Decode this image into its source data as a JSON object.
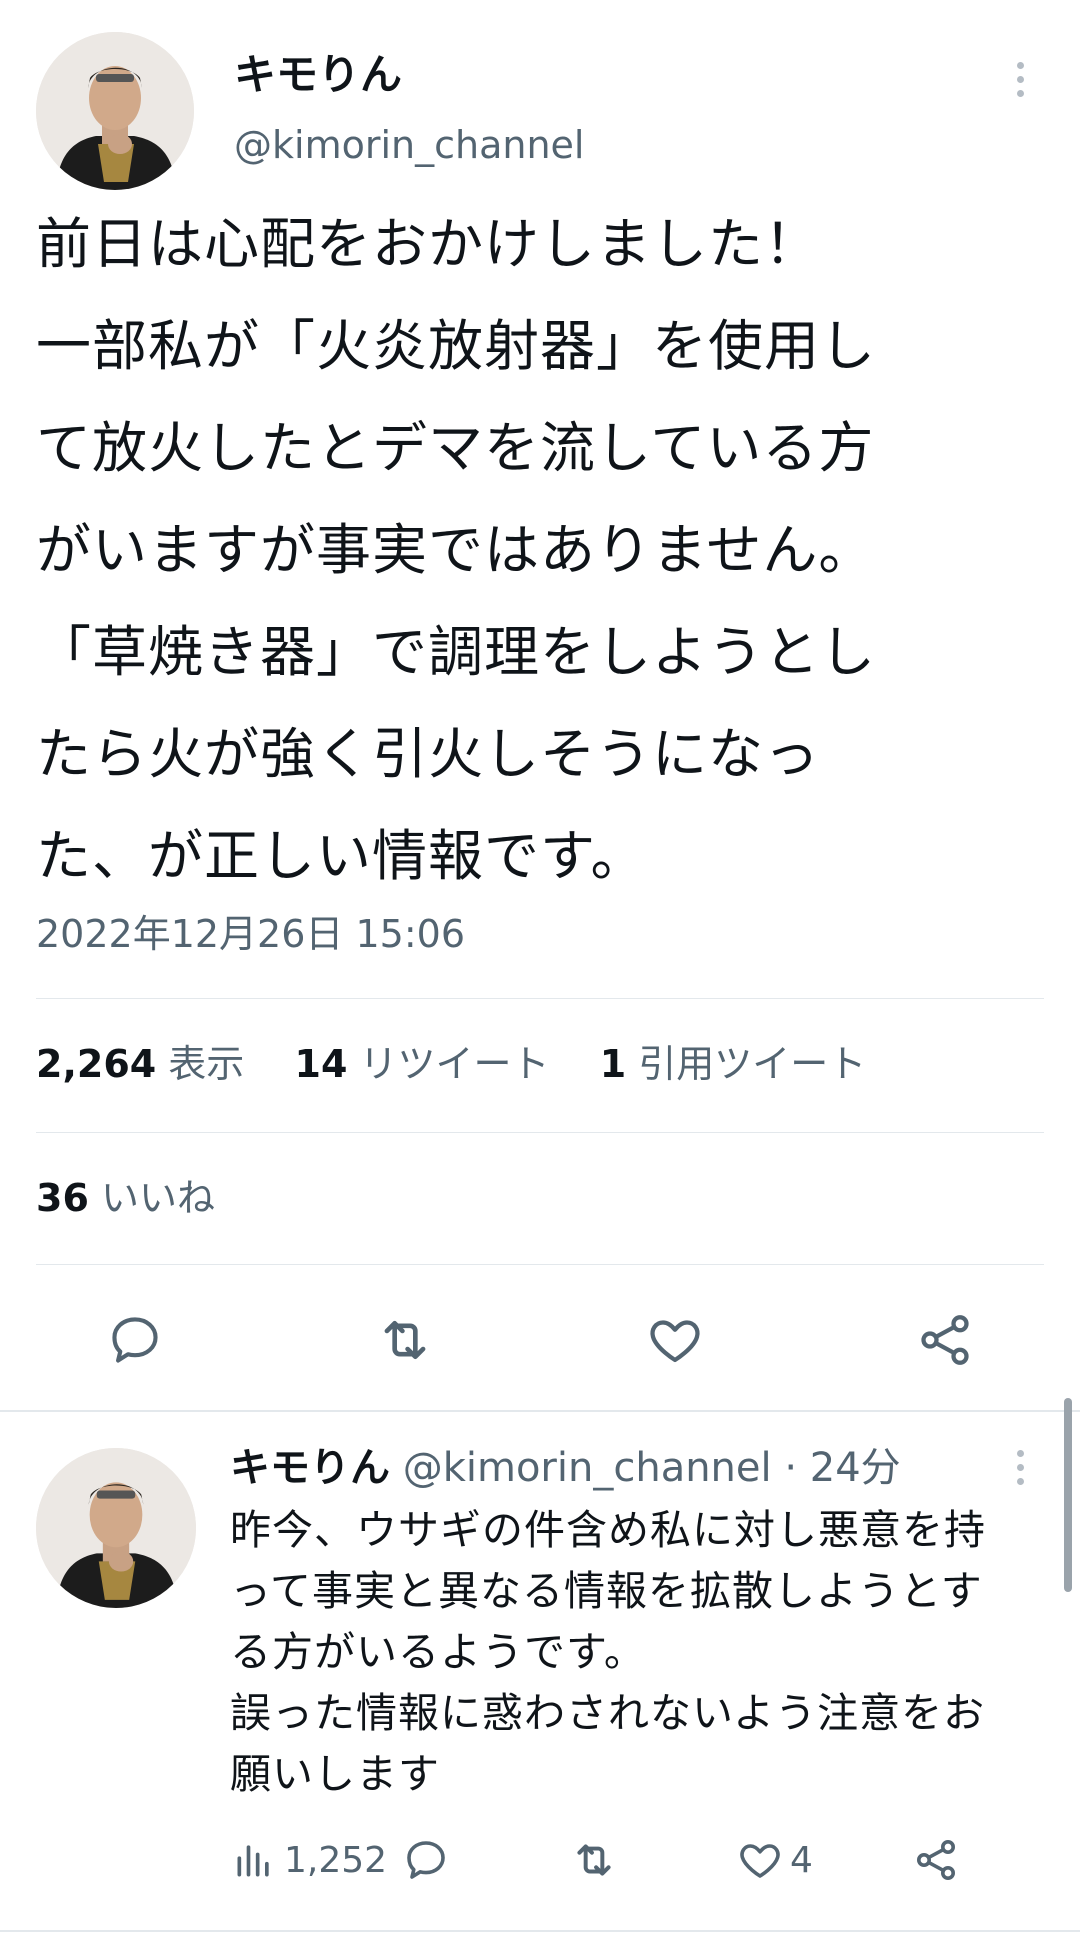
{
  "main_tweet": {
    "author_name": "キモりん",
    "author_handle": "@kimorin_channel",
    "lines": [
      "前日は心配をおかけしました！",
      "一部私が「火炎放射器」を使用し",
      "て放火したとデマを流している方",
      "がいますが事実ではありません。",
      "「草焼き器」で調理をしようとし",
      "たら火が強く引火しそうになっ",
      "た、が正しい情報です。"
    ],
    "timestamp": "2022年12月26日 15:06",
    "stats": {
      "views_count": "2,264",
      "views_label": "表示",
      "retweets_count": "14",
      "retweets_label": "リツイート",
      "quotes_count": "1",
      "quotes_label": "引用ツイート",
      "likes_count": "36",
      "likes_label": "いいね"
    },
    "actions": [
      "reply-icon",
      "retweet-icon",
      "like-icon",
      "share-icon"
    ]
  },
  "reply_tweet": {
    "author_name": "キモりん",
    "author_handle": "@kimorin_channel",
    "separator": "·",
    "time": "24分",
    "lines": [
      "昨今、ウサギの件含め私に対し悪意を持",
      "って事実と異なる情報を拡散しようとす",
      "る方がいるようです。",
      "誤った情報に惑わされないよう注意をお",
      "願いします"
    ],
    "views": "1,252",
    "likes": "4",
    "actions": [
      "views-icon",
      "reply-icon",
      "retweet-icon",
      "like-icon",
      "share-icon"
    ]
  },
  "colors": {
    "text": "#0f1419",
    "muted": "#536471",
    "divider": "#e3e8ec",
    "icon": "#536471"
  }
}
